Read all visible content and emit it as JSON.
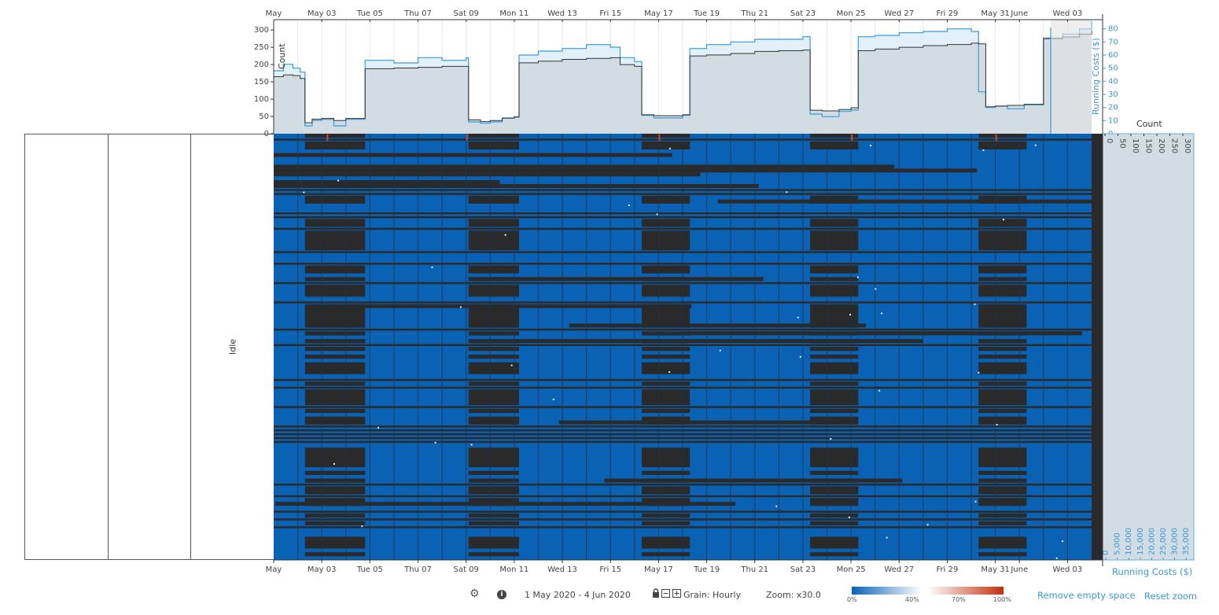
{
  "chart_data": [
    {
      "type": "area",
      "title": "",
      "x_axis": {
        "range": [
          "2020-05-01",
          "2020-06-04"
        ],
        "tick_labels": [
          "May",
          "May 03",
          "Tue 05",
          "Thu 07",
          "Sat 09",
          "Mon 11",
          "Wed 13",
          "Fri 15",
          "May 17",
          "Tue 19",
          "Thu 21",
          "Sat 23",
          "Mon 25",
          "Wed 27",
          "Fri 29",
          "May 31",
          "June",
          "Wed 03"
        ],
        "tick_days": [
          0,
          2,
          4,
          6,
          8,
          10,
          12,
          14,
          16,
          18,
          20,
          22,
          24,
          26,
          28,
          30,
          31,
          33
        ]
      },
      "y_left": {
        "label": "Count",
        "ticks": [
          0,
          50,
          100,
          150,
          200,
          250,
          300
        ],
        "range": [
          0,
          330
        ]
      },
      "y_right": {
        "label": "Running Costs ($)",
        "ticks": [
          0,
          10,
          20,
          30,
          40,
          50,
          60,
          70,
          80
        ],
        "range": [
          0,
          87
        ]
      },
      "series": [
        {
          "name": "Count",
          "axis": "left",
          "color": "#333333",
          "x_days": [
            0,
            0.4,
            0.8,
            1.1,
            1.3,
            1.6,
            2.0,
            2.5,
            3.0,
            3.5,
            3.8,
            5.0,
            6.0,
            7.0,
            8.0,
            8.1,
            8.6,
            9.0,
            9.5,
            10.0,
            10.2,
            11.0,
            12.0,
            13.0,
            14.0,
            14.4,
            15.0,
            15.3,
            15.8,
            16.5,
            17.0,
            17.3,
            18.0,
            19.0,
            20.0,
            21.0,
            22.0,
            22.3,
            22.8,
            23.5,
            24.0,
            24.3,
            25.0,
            26.0,
            27.0,
            28.0,
            29.0,
            29.3,
            29.6,
            30.0,
            30.5,
            31.2,
            32.0,
            32.8,
            33.5,
            34.0
          ],
          "values": [
            165,
            170,
            168,
            160,
            32,
            42,
            44,
            38,
            44,
            44,
            188,
            190,
            192,
            195,
            195,
            40,
            35,
            38,
            45,
            48,
            205,
            210,
            215,
            218,
            220,
            200,
            195,
            55,
            52,
            52,
            55,
            225,
            228,
            232,
            238,
            240,
            242,
            68,
            66,
            70,
            75,
            240,
            245,
            250,
            255,
            258,
            262,
            260,
            78,
            80,
            82,
            85,
            275,
            280,
            288,
            300
          ]
        },
        {
          "name": "Running Costs ($)",
          "axis": "right",
          "color": "#3a9ad9",
          "x_days": [
            0,
            0.4,
            0.8,
            1.1,
            1.3,
            1.6,
            2.0,
            2.5,
            3.0,
            3.5,
            3.8,
            5.0,
            6.0,
            7.0,
            8.0,
            8.1,
            8.6,
            9.0,
            9.5,
            10.0,
            10.2,
            11.0,
            12.0,
            13.0,
            14.0,
            14.4,
            15.0,
            15.3,
            15.8,
            16.5,
            17.0,
            17.3,
            18.0,
            19.0,
            20.0,
            21.0,
            22.0,
            22.3,
            22.8,
            23.5,
            24.0,
            24.3,
            25.0,
            26.0,
            27.0,
            28.0,
            29.0,
            29.3,
            29.6,
            30.0,
            30.5,
            31.2,
            32.0,
            32.8,
            33.5,
            34.0
          ],
          "values": [
            48,
            53,
            50,
            47,
            6,
            10,
            11,
            6,
            11,
            11,
            56,
            54,
            58,
            56,
            58,
            9,
            8,
            9,
            12,
            13,
            60,
            63,
            65,
            68,
            66,
            58,
            55,
            14,
            12,
            12,
            14,
            65,
            68,
            70,
            72,
            72,
            74,
            15,
            13,
            17,
            18,
            74,
            75,
            77,
            78,
            80,
            78,
            32,
            20,
            21,
            19,
            22,
            73,
            76,
            80,
            86
          ]
        }
      ]
    },
    {
      "type": "heatmap",
      "title": "",
      "xlabel": "",
      "x_range": [
        "1 May 2020",
        "4 Jun 2020"
      ],
      "grain": "Hourly",
      "row_group": "Idle",
      "weekend_gaps_days": [
        [
          1.3,
          3.8
        ],
        [
          8.1,
          10.2
        ],
        [
          15.3,
          17.3
        ],
        [
          22.3,
          24.3
        ],
        [
          29.3,
          31.3
        ]
      ],
      "color_scale": {
        "stops": [
          0,
          40,
          70,
          100
        ],
        "labels": [
          "0%",
          "40%",
          "70%",
          "100%"
        ],
        "colors": [
          "#0862b5",
          "#ffffff",
          "#f0c8b8",
          "#c0300f"
        ]
      },
      "right_axis_count": {
        "label": "Count",
        "ticks": [
          0,
          50,
          100,
          150,
          200,
          250,
          300
        ]
      },
      "right_axis_costs": {
        "label": "Running Costs ($)",
        "ticks": [
          "0",
          "5,000",
          "10,000",
          "15,000",
          "20,000",
          "25,000",
          "30,000",
          "35,000"
        ]
      }
    }
  ],
  "left_panel": {
    "categories": [
      {
        "label": "",
        "color": "#88b4d6"
      },
      {
        "label": "",
        "color": "#b1cee6"
      },
      {
        "label": "Idle",
        "color": "#4a8dc2"
      }
    ]
  },
  "footer": {
    "settings_icon": "gear-icon",
    "info_icon": "info-icon",
    "date_range": "1 May 2020 - 4 Jun 2020",
    "lock_icon": "lock-icon",
    "collapse_icon": "minus-box-icon",
    "expand_icon": "plus-box-icon",
    "grain": "Grain: Hourly",
    "zoom": "Zoom: x30.0",
    "legend_labels": [
      "0%",
      "40%",
      "70%",
      "100%"
    ],
    "remove_empty_space": "Remove empty space",
    "reset_zoom": "Reset zoom"
  }
}
